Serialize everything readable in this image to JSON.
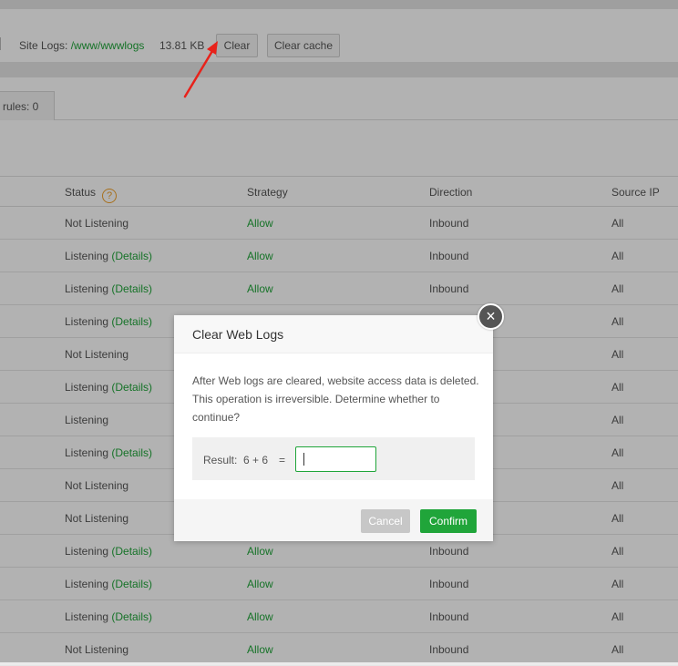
{
  "log_bar": {
    "label": "Site Logs: ",
    "path": "/www/wwwlogs",
    "size": "13.81 KB",
    "clear_button": "Clear",
    "clear_cache_button": "Clear cache"
  },
  "tab": {
    "label": "rules: 0"
  },
  "table": {
    "headers": [
      "Status",
      "Strategy",
      "Direction",
      "Source IP"
    ],
    "help_icon": "?",
    "rows": [
      {
        "status": "Not Listening",
        "details": "",
        "strategy": "Allow",
        "direction": "Inbound",
        "source": "All"
      },
      {
        "status": "Listening ",
        "details": "(Details)",
        "strategy": "Allow",
        "direction": "Inbound",
        "source": "All"
      },
      {
        "status": "Listening ",
        "details": "(Details)",
        "strategy": "Allow",
        "direction": "Inbound",
        "source": "All"
      },
      {
        "status": "Listening ",
        "details": "(Details)",
        "strategy": "",
        "direction": "",
        "source": "All"
      },
      {
        "status": "Not Listening",
        "details": "",
        "strategy": "",
        "direction": "",
        "source": "All"
      },
      {
        "status": "Listening ",
        "details": "(Details)",
        "strategy": "",
        "direction": "",
        "source": "All"
      },
      {
        "status": "Listening",
        "details": "",
        "strategy": "",
        "direction": "",
        "source": "All"
      },
      {
        "status": "Listening ",
        "details": "(Details)",
        "strategy": "",
        "direction": "",
        "source": "All"
      },
      {
        "status": "Not Listening",
        "details": "",
        "strategy": "",
        "direction": "",
        "source": "All"
      },
      {
        "status": "Not Listening",
        "details": "",
        "strategy": "",
        "direction": "",
        "source": "All"
      },
      {
        "status": "Listening ",
        "details": "(Details)",
        "strategy": "Allow",
        "direction": "Inbound",
        "source": "All"
      },
      {
        "status": "Listening ",
        "details": "(Details)",
        "strategy": "Allow",
        "direction": "Inbound",
        "source": "All"
      },
      {
        "status": "Listening ",
        "details": "(Details)",
        "strategy": "Allow",
        "direction": "Inbound",
        "source": "All"
      },
      {
        "status": "Not Listening",
        "details": "",
        "strategy": "Allow",
        "direction": "Inbound",
        "source": "All"
      }
    ]
  },
  "dialog": {
    "title": "Clear Web Logs",
    "close": "×",
    "message": "After Web logs are cleared, website access data is deleted. This operation is irreversible. Determine whether to continue?",
    "captcha_label": "Result:",
    "captcha_question": "6 + 6",
    "captcha_equals": "=",
    "captcha_value": "",
    "cancel": "Cancel",
    "confirm": "Confirm"
  },
  "colors": {
    "accent": "#20a53a",
    "help_icon": "#f0a029",
    "annotation_arrow": "#e8221b"
  },
  "icons": {
    "help": "question-circle-icon",
    "close": "close-circle-icon",
    "annotation": "red-arrow-annotation"
  }
}
